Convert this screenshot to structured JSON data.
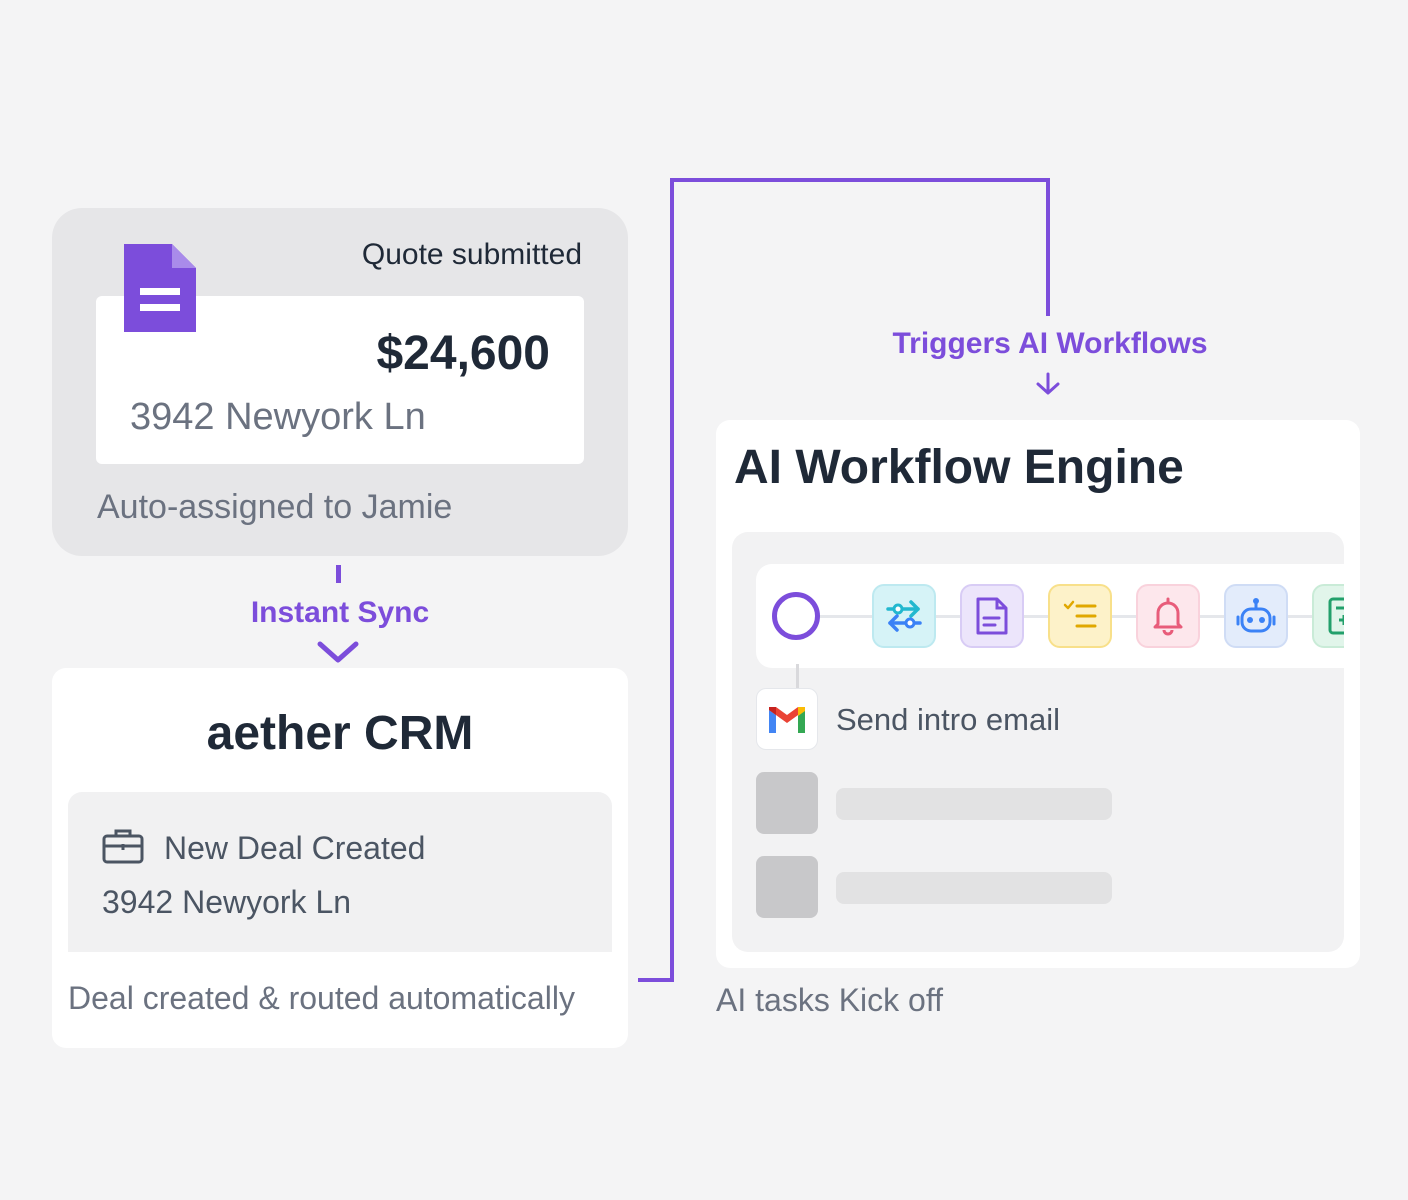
{
  "quote": {
    "title": "Quote submitted",
    "amount": "$24,600",
    "address": "3942 Newyork Ln",
    "assignee": "Auto-assigned to Jamie",
    "icon": "document-icon"
  },
  "sync": {
    "label": "Instant Sync"
  },
  "crm": {
    "title": "aether CRM",
    "deal_title": "New Deal Created",
    "deal_address": "3942 Newyork Ln",
    "footer": "Deal created & routed automatically",
    "icon": "briefcase-icon"
  },
  "trigger": {
    "label": "Triggers AI Workflows"
  },
  "engine": {
    "title": "AI Workflow Engine",
    "steps": [
      {
        "name": "sync-step",
        "icon": "arrows-exchange-icon",
        "color": "#22b8cf"
      },
      {
        "name": "document-step",
        "icon": "document-text-icon",
        "color": "#7c4ddb"
      },
      {
        "name": "checklist-step",
        "icon": "checklist-icon",
        "color": "#e0a800"
      },
      {
        "name": "notification-step",
        "icon": "bell-icon",
        "color": "#e85c7a"
      },
      {
        "name": "bot-step",
        "icon": "robot-icon",
        "color": "#3b82f6"
      },
      {
        "name": "sheet-step",
        "icon": "spreadsheet-icon",
        "color": "#22a06b"
      }
    ],
    "task_label": "Send intro email",
    "task_icon": "gmail-icon",
    "footer": "AI tasks Kick off"
  },
  "colors": {
    "accent": "#7c4ddb",
    "text_dark": "#1f2937",
    "text_muted": "#6b7280"
  }
}
